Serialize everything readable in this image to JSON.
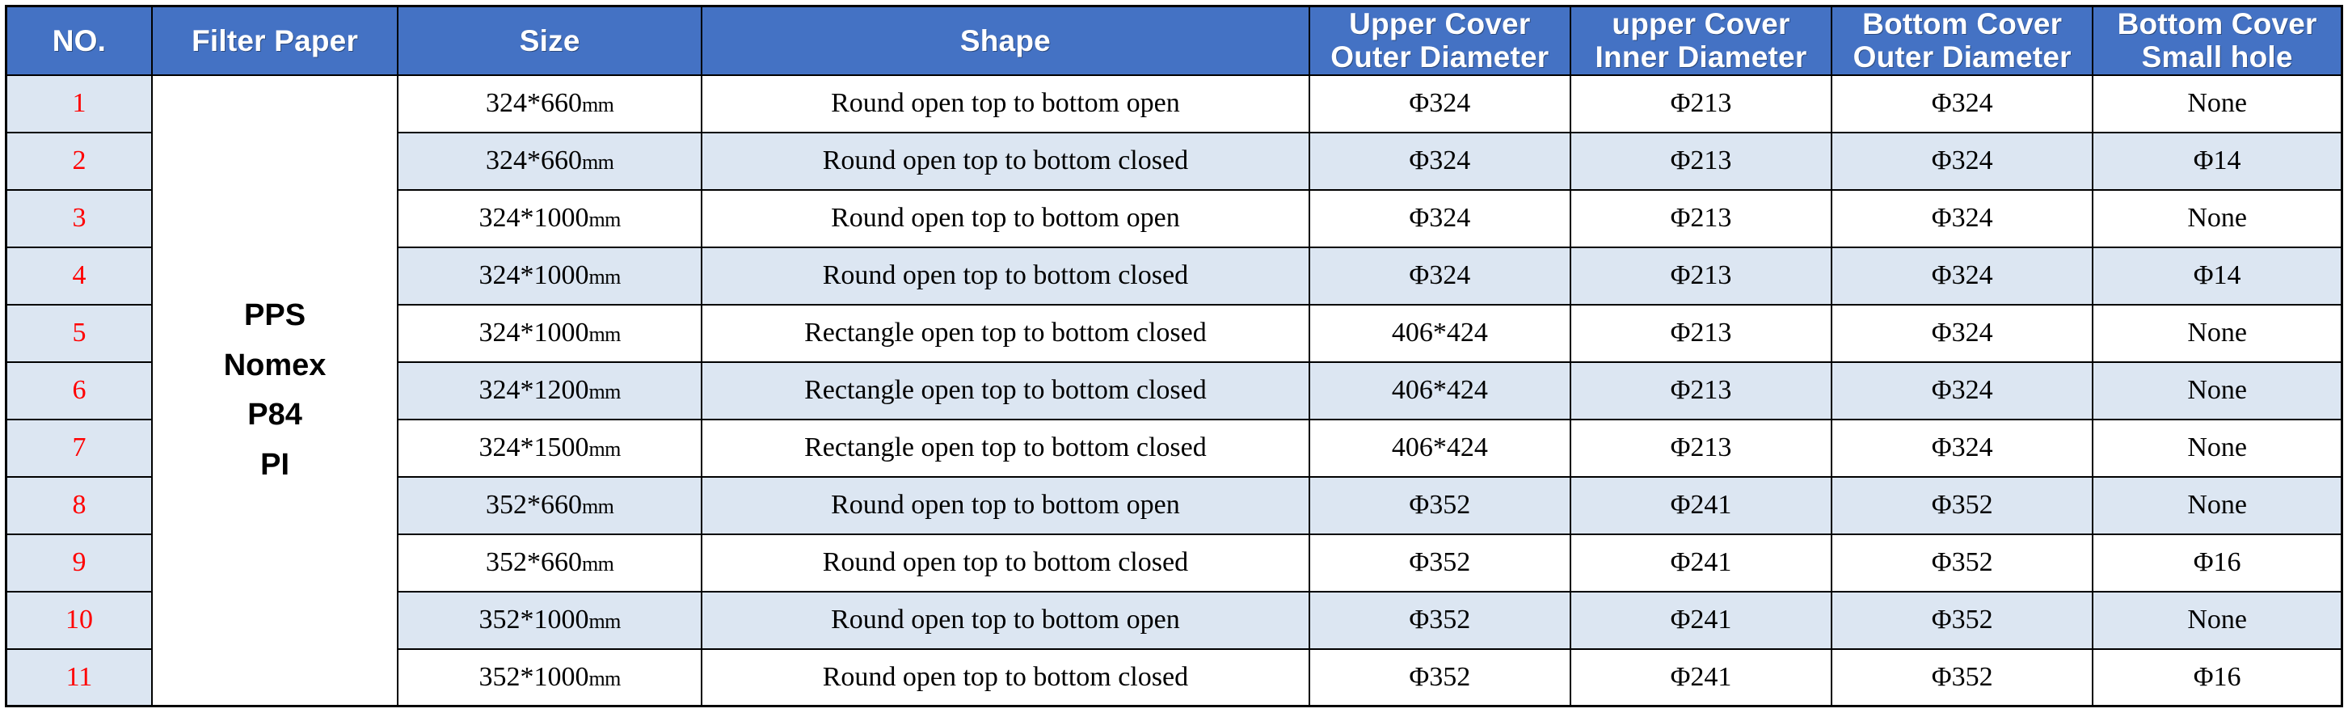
{
  "table": {
    "columns": [
      {
        "key": "no",
        "label_lines": [
          "NO."
        ]
      },
      {
        "key": "filter_paper",
        "label_lines": [
          "Filter Paper"
        ]
      },
      {
        "key": "size",
        "label_lines": [
          "Size"
        ]
      },
      {
        "key": "shape",
        "label_lines": [
          "Shape"
        ]
      },
      {
        "key": "upper_outer",
        "label_lines": [
          "Upper Cover",
          "Outer Diameter"
        ]
      },
      {
        "key": "upper_inner",
        "label_lines": [
          "upper Cover",
          "Inner Diameter"
        ]
      },
      {
        "key": "bottom_outer",
        "label_lines": [
          "Bottom Cover",
          "Outer Diameter"
        ]
      },
      {
        "key": "bottom_hole",
        "label_lines": [
          "Bottom Cover",
          "Small hole"
        ]
      }
    ],
    "filter_paper_merged_lines": [
      "PPS",
      "Nomex",
      "P84",
      "PI"
    ],
    "rows": [
      {
        "no": "1",
        "size_value": "324*660",
        "size_unit": "mm",
        "shape": "Round open top to bottom open",
        "upper_outer": "Φ324",
        "upper_inner": "Φ213",
        "bottom_outer": "Φ324",
        "bottom_hole": "None"
      },
      {
        "no": "2",
        "size_value": "324*660",
        "size_unit": "mm",
        "shape": "Round open top to bottom closed",
        "upper_outer": "Φ324",
        "upper_inner": "Φ213",
        "bottom_outer": "Φ324",
        "bottom_hole": "Φ14"
      },
      {
        "no": "3",
        "size_value": "324*1000",
        "size_unit": "mm",
        "shape": "Round open top to bottom open",
        "upper_outer": "Φ324",
        "upper_inner": "Φ213",
        "bottom_outer": "Φ324",
        "bottom_hole": "None"
      },
      {
        "no": "4",
        "size_value": "324*1000",
        "size_unit": "mm",
        "shape": "Round open top to bottom closed",
        "upper_outer": "Φ324",
        "upper_inner": "Φ213",
        "bottom_outer": "Φ324",
        "bottom_hole": "Φ14"
      },
      {
        "no": "5",
        "size_value": "324*1000",
        "size_unit": "mm",
        "shape": "Rectangle open top to bottom closed",
        "upper_outer": "406*424",
        "upper_inner": "Φ213",
        "bottom_outer": "Φ324",
        "bottom_hole": "None"
      },
      {
        "no": "6",
        "size_value": "324*1200",
        "size_unit": "mm",
        "shape": "Rectangle open top to bottom closed",
        "upper_outer": "406*424",
        "upper_inner": "Φ213",
        "bottom_outer": "Φ324",
        "bottom_hole": "None"
      },
      {
        "no": "7",
        "size_value": "324*1500",
        "size_unit": "mm",
        "shape": "Rectangle open top to bottom closed",
        "upper_outer": "406*424",
        "upper_inner": "Φ213",
        "bottom_outer": "Φ324",
        "bottom_hole": "None"
      },
      {
        "no": "8",
        "size_value": "352*660",
        "size_unit": "mm",
        "shape": "Round open top to bottom open",
        "upper_outer": "Φ352",
        "upper_inner": "Φ241",
        "bottom_outer": "Φ352",
        "bottom_hole": "None"
      },
      {
        "no": "9",
        "size_value": "352*660",
        "size_unit": "mm",
        "shape": "Round open top to bottom closed",
        "upper_outer": "Φ352",
        "upper_inner": "Φ241",
        "bottom_outer": "Φ352",
        "bottom_hole": "Φ16"
      },
      {
        "no": "10",
        "size_value": "352*1000",
        "size_unit": "mm",
        "shape": "Round open top to bottom open",
        "upper_outer": "Φ352",
        "upper_inner": "Φ241",
        "bottom_outer": "Φ352",
        "bottom_hole": "None"
      },
      {
        "no": "11",
        "size_value": "352*1000",
        "size_unit": "mm",
        "shape": "Round open top to bottom closed",
        "upper_outer": "Φ352",
        "upper_inner": "Φ241",
        "bottom_outer": "Φ352",
        "bottom_hole": "Φ16"
      }
    ]
  },
  "colors": {
    "header_background": "#4472C4",
    "header_text": "#FFFFFF",
    "row_alt_background": "#DCE6F2",
    "row_background": "#FFFFFF",
    "no_column_background": "#DCE6F2",
    "no_column_text": "#FF0000",
    "border": "#000000"
  }
}
